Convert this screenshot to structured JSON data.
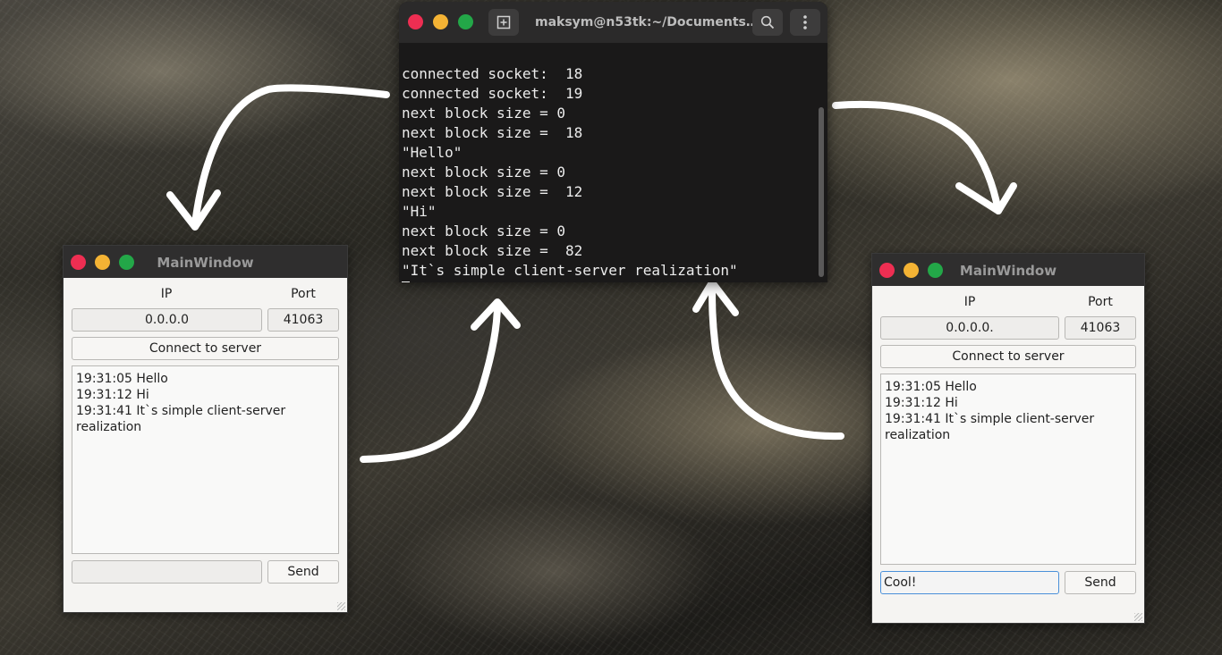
{
  "terminal": {
    "title": "maksym@n53tk:~/Documents…",
    "lines": [
      "connected socket:  18",
      "connected socket:  19",
      "next block size = 0",
      "next block size =  18",
      "\"Hello\"",
      "next block size = 0",
      "next block size =  12",
      "\"Hi\"",
      "next block size = 0",
      "next block size =  82",
      "\"It`s simple client-server realization\""
    ],
    "new_tab_icon": "new-tab-icon",
    "search_icon": "search-icon",
    "menu_icon": "kebab-menu-icon"
  },
  "left_window": {
    "title": "MainWindow",
    "ip_label": "IP",
    "port_label": "Port",
    "ip_value": "0.0.0.0",
    "port_value": "41063",
    "connect_label": "Connect to server",
    "messages": [
      "19:31:05 Hello",
      "19:31:12 Hi",
      "19:31:41 It`s simple client-server realization"
    ],
    "message_input": "",
    "send_label": "Send"
  },
  "right_window": {
    "title": "MainWindow",
    "ip_label": "IP",
    "port_label": "Port",
    "ip_value": "0.0.0.0.",
    "port_value": "41063",
    "connect_label": "Connect to server",
    "messages": [
      "19:31:05 Hello",
      "19:31:12 Hi",
      "19:31:41 It`s simple client-server realization"
    ],
    "message_input": "Cool!",
    "send_label": "Send"
  },
  "colors": {
    "close": "#ee2e52",
    "minimize": "#f4b334",
    "maximize": "#23a748",
    "terminal_bg": "#1a1919",
    "window_bg": "#f5f4f2"
  }
}
